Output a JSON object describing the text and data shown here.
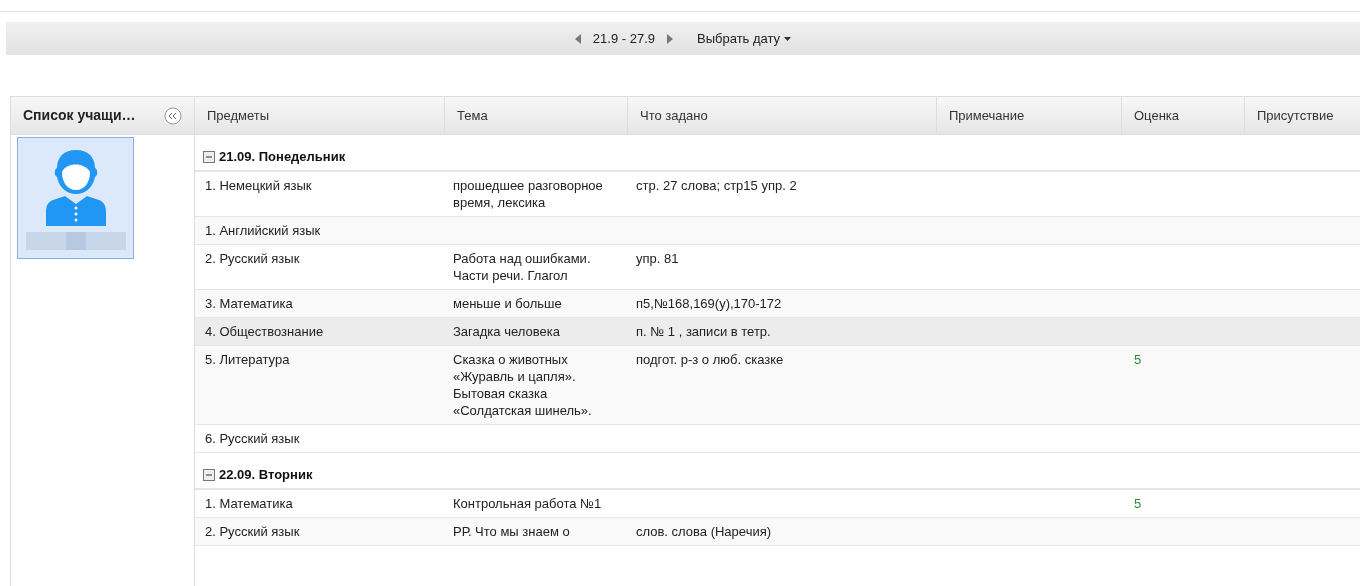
{
  "week_nav": {
    "range": "21.9 - 27.9",
    "pick_date": "Выбрать дату"
  },
  "student_panel": {
    "title": "Список учащи…",
    "students": [
      {
        "selected": true
      }
    ]
  },
  "table": {
    "columns": [
      "Предметы",
      "Тема",
      "Что задано",
      "Примечание",
      "Оценка",
      "Присутствие"
    ],
    "days": [
      {
        "title": "21.09. Понедельник",
        "expanded": true,
        "rows": [
          {
            "subject": "1. Немецкий язык",
            "topic": "прошедшее разговорное время, лексика",
            "homework": "стр. 27 слова; стр15 упр. 2",
            "highlighted": false
          },
          {
            "subject": "1. Английский язык",
            "highlighted": false
          },
          {
            "subject": "2. Русский язык",
            "topic": "Работа над ошибками. Части речи. Глагол",
            "homework": "упр. 81",
            "highlighted": false
          },
          {
            "subject": "3. Математика",
            "topic": "меньше и больше",
            "homework": "п5,№168,169(у),170-172",
            "highlighted": false
          },
          {
            "subject": "4. Обществознание",
            "topic": "Загадка человека",
            "homework": "п. № 1 , записи в тетр.",
            "highlighted": true
          },
          {
            "subject": "5. Литература",
            "topic": "Сказка о животных «Журавль и цапля». Бытовая сказка «Солдатская шинель».",
            "homework": "подгот. р-з о люб. сказке",
            "grade": "5",
            "highlighted": false
          },
          {
            "subject": "6. Русский язык",
            "highlighted": false
          }
        ]
      },
      {
        "title": "22.09. Вторник",
        "expanded": true,
        "rows": [
          {
            "subject": "1. Математика",
            "topic": "Контрольная работа №1",
            "grade": "5",
            "highlighted": false
          },
          {
            "subject": "2. Русский язык",
            "topic": "РР. Что мы знаем о",
            "homework": "слов. слова (Наречия)",
            "highlighted": false
          }
        ]
      }
    ]
  }
}
